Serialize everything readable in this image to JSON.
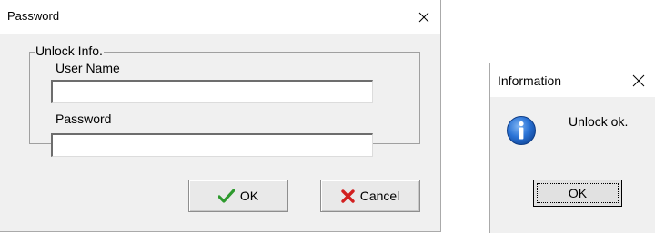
{
  "password_dialog": {
    "title": "Password",
    "group_label": "Unlock Info.",
    "user_name_label": "User Name",
    "user_name_value": "",
    "password_label": "Password",
    "password_value": "",
    "ok_label": "OK",
    "cancel_label": "Cancel",
    "icons": {
      "close": "close-icon",
      "ok": "checkmark-icon",
      "cancel": "red-x-icon"
    }
  },
  "info_dialog": {
    "title": "Information",
    "message": "Unlock ok.",
    "ok_label": "OK",
    "icons": {
      "close": "close-icon",
      "info": "info-icon"
    }
  },
  "colors": {
    "dialog_bg": "#f0f0f0",
    "titlebar_bg": "#ffffff",
    "ok_check": "#2e9a2e",
    "cancel_x": "#d22020",
    "info_blue": "#1f63c6"
  }
}
